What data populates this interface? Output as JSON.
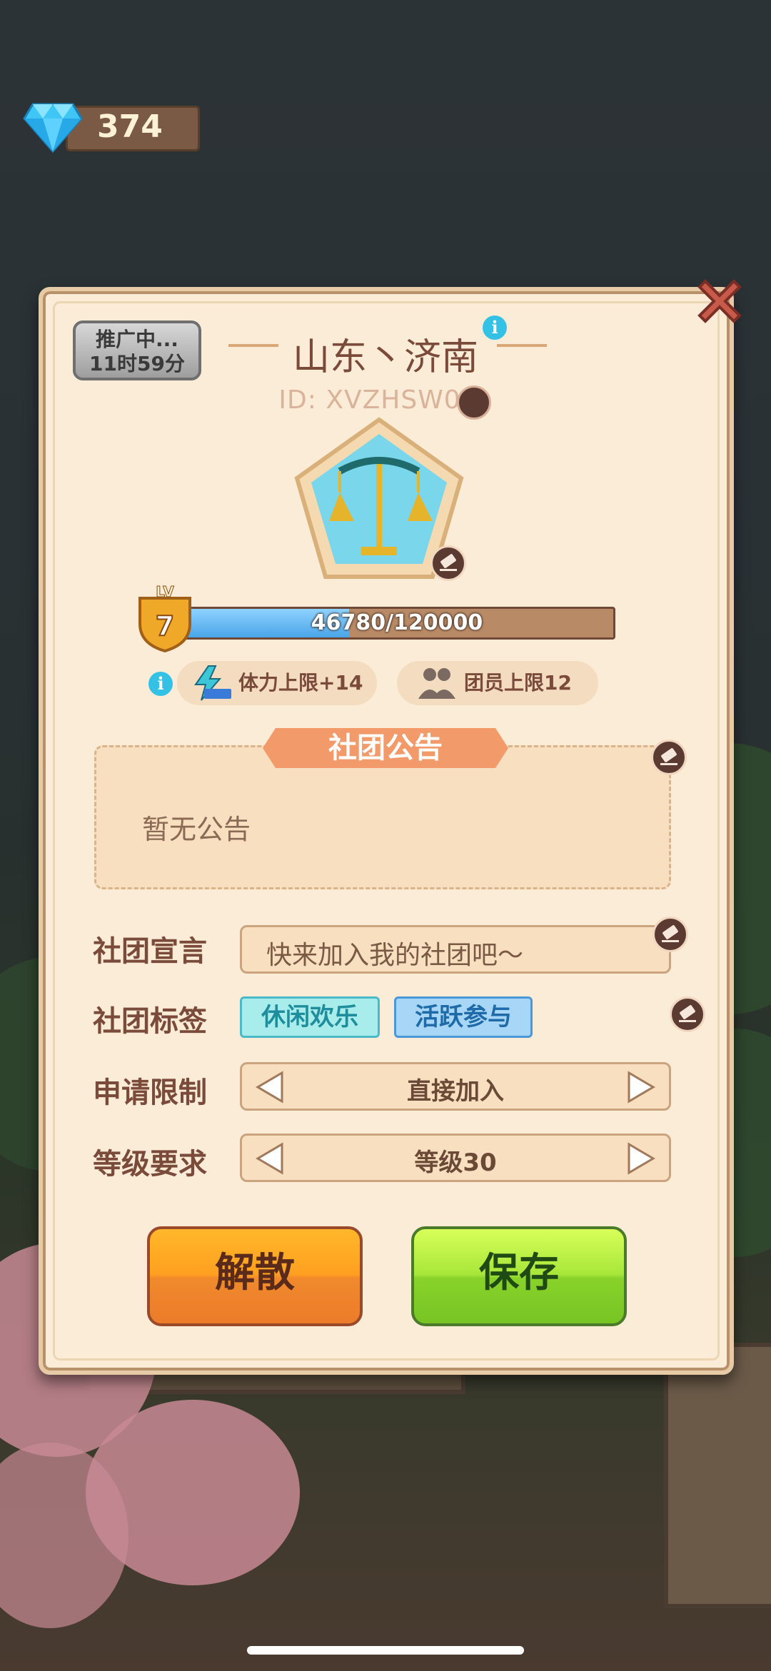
{
  "currency": {
    "gem_count": "374",
    "icon": "diamond-icon"
  },
  "club": {
    "promo_label_1": "推广中...",
    "promo_label_2": "11时59分",
    "name": "山东丶济南",
    "id_text": "ID: XVZHSW01",
    "level_label": "LV",
    "level": "7",
    "exp_text": "46780/120000",
    "exp_progress": 0.39,
    "perk_stamina": "体力上限+14",
    "perk_members": "团员上限12"
  },
  "notice": {
    "title": "社团公告",
    "text": "暂无公告"
  },
  "form": {
    "declaration_label": "社团宣言",
    "declaration_value": "快来加入我的社团吧～",
    "tags_label": "社团标签",
    "tags": [
      "休闲欢乐",
      "活跃参与"
    ],
    "apply_label": "申请限制",
    "apply_value": "直接加入",
    "level_label": "等级要求",
    "level_value": "等级30"
  },
  "buttons": {
    "disband": "解散",
    "save": "保存"
  },
  "colors": {
    "accent_brown": "#7a4a3a",
    "save_green": "#88d22a",
    "disband_orange": "#ffa020",
    "info_blue": "#33c2e6"
  }
}
